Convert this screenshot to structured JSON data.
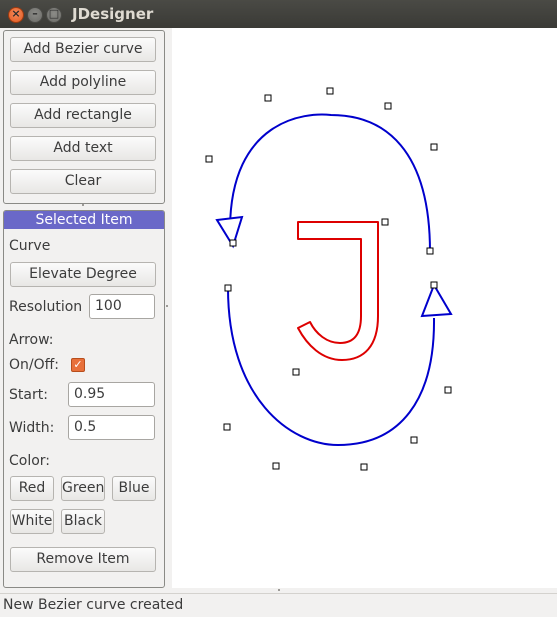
{
  "window": {
    "title": "JDesigner"
  },
  "toolbar": {
    "add_bezier": "Add Bezier curve",
    "add_polyline": "Add polyline",
    "add_rectangle": "Add rectangle",
    "add_text": "Add text",
    "clear": "Clear"
  },
  "selected": {
    "header": "Selected Item",
    "type_label": "Curve",
    "elevate_degree": "Elevate Degree",
    "resolution_label": "Resolution",
    "resolution_value": "100",
    "arrow_label": "Arrow:",
    "onoff_label": "On/Off:",
    "arrow_checked": true,
    "start_label": "Start:",
    "start_value": "0.95",
    "width_label": "Width:",
    "width_value": "0.5",
    "color_label": "Color:",
    "colors": {
      "red": "Red",
      "green": "Green",
      "blue": "Blue",
      "white": "White",
      "black": "Black"
    },
    "remove_item": "Remove Item"
  },
  "canvas": {
    "curve_color": "#0000cc",
    "letter_color": "#dd0000",
    "letter": "J"
  },
  "status": {
    "text": "New Bezier curve created"
  },
  "icons": {
    "close": "close-icon",
    "minimize": "minimize-icon",
    "maximize": "maximize-icon",
    "checkbox": "checkmark-icon"
  }
}
